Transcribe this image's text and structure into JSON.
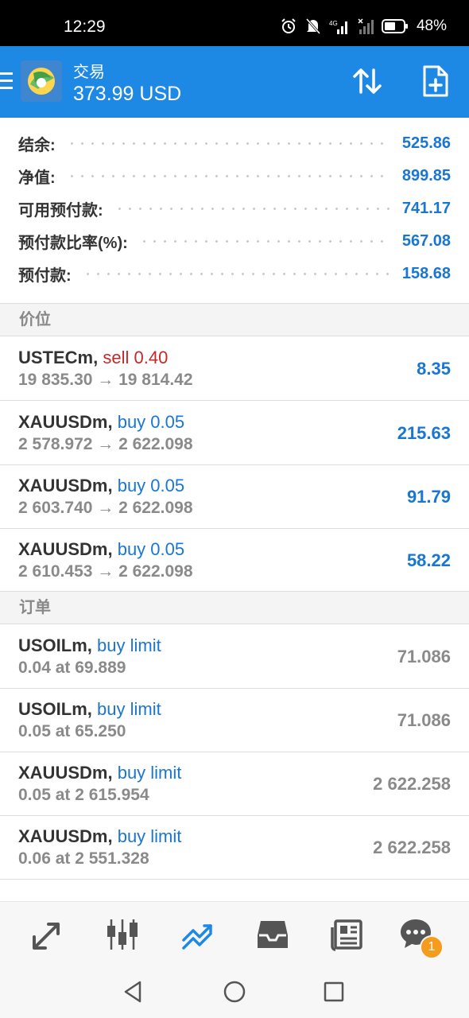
{
  "status_bar": {
    "time": "12:29",
    "battery": "48%"
  },
  "app_bar": {
    "title": "交易",
    "balance": "373.99 USD"
  },
  "summary": [
    {
      "label": "结余:",
      "value": "525.86"
    },
    {
      "label": "净值:",
      "value": "899.85"
    },
    {
      "label": "可用预付款:",
      "value": "741.17"
    },
    {
      "label": "预付款比率(%):",
      "value": "567.08"
    },
    {
      "label": "预付款:",
      "value": "158.68"
    }
  ],
  "positions_header": "价位",
  "positions": [
    {
      "symbol": "USTECm,",
      "side": "sell 0.40",
      "prices": "19 835.30 → 19 814.42",
      "profit": "8.35"
    },
    {
      "symbol": "XAUUSDm,",
      "side": "buy 0.05",
      "prices": "2 578.972 → 2 622.098",
      "profit": "215.63"
    },
    {
      "symbol": "XAUUSDm,",
      "side": "buy 0.05",
      "prices": "2 603.740 → 2 622.098",
      "profit": "91.79"
    },
    {
      "symbol": "XAUUSDm,",
      "side": "buy 0.05",
      "prices": "2 610.453 → 2 622.098",
      "profit": "58.22"
    }
  ],
  "orders_header": "订单",
  "orders": [
    {
      "symbol": "USOILm,",
      "type": "buy limit",
      "detail": "0.04 at 69.889",
      "price": "71.086"
    },
    {
      "symbol": "USOILm,",
      "type": "buy limit",
      "detail": "0.05 at 65.250",
      "price": "71.086"
    },
    {
      "symbol": "XAUUSDm,",
      "type": "buy limit",
      "detail": "0.05 at 2 615.954",
      "price": "2 622.258"
    },
    {
      "symbol": "XAUUSDm,",
      "type": "buy limit",
      "detail": "0.06 at 2 551.328",
      "price": "2 622.258"
    }
  ],
  "bottom_nav": {
    "items": [
      "quotes-icon",
      "chart-icon",
      "trade-icon",
      "history-icon",
      "news-icon",
      "chat-icon"
    ],
    "chat_badge": "1",
    "active": "trade-icon"
  },
  "colors": {
    "accent": "#1e88e5",
    "profit": "#1976d2",
    "sell": "#c62828",
    "badge": "#f59b1e"
  }
}
